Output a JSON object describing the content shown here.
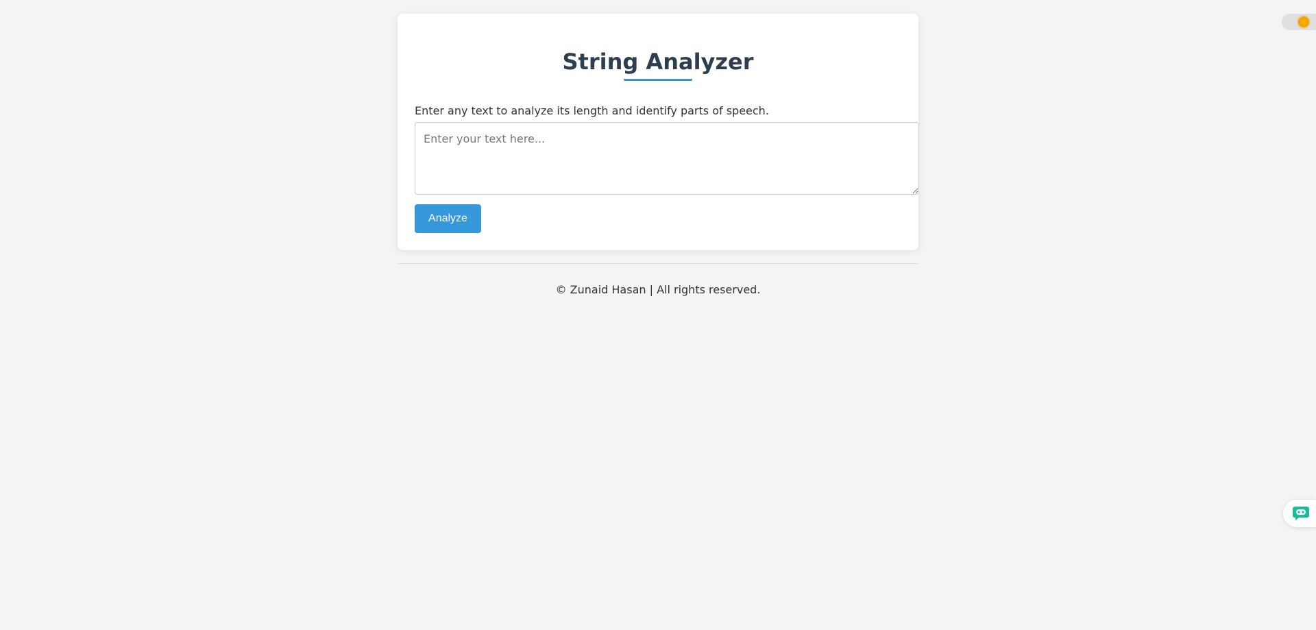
{
  "card": {
    "title": "String Analyzer",
    "description": "Enter any text to analyze its length and identify parts of speech.",
    "input": {
      "placeholder": "Enter your text here...",
      "value": ""
    },
    "analyze_label": "Analyze"
  },
  "footer": {
    "text": "© Zunaid Hasan | All rights reserved."
  },
  "theme_toggle": {
    "icon": "sun-icon"
  },
  "chat_widget": {
    "icon": "chat-bot-icon"
  },
  "colors": {
    "background": "#f4f4f4",
    "accent": "#3498db",
    "title": "#2c3e50",
    "chat": "#1abc9c"
  }
}
